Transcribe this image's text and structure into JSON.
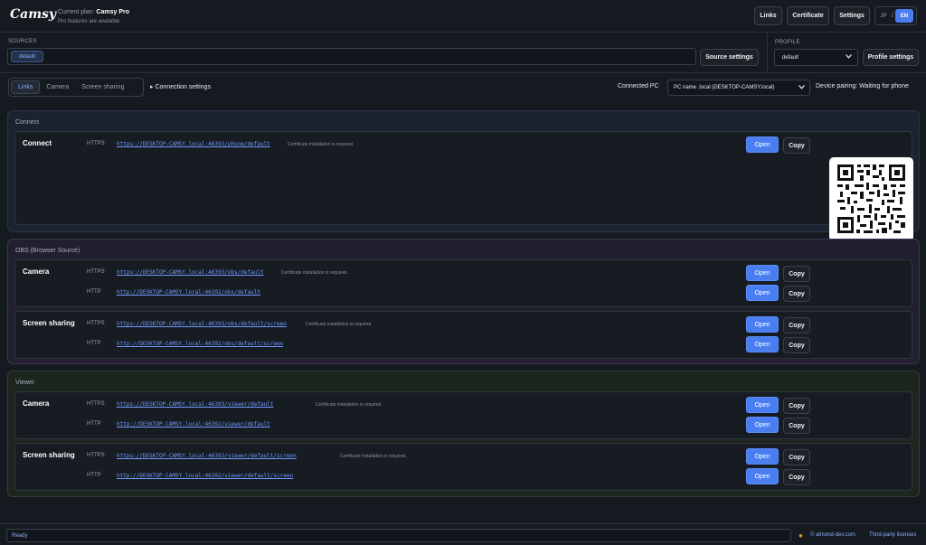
{
  "app": {
    "logo": "Camsy",
    "plan_label": "Current plan:",
    "plan_name": "Camsy Pro",
    "plan_note": "Pro features are available"
  },
  "header": {
    "links_label": "Links",
    "certificate_label": "Certificate",
    "settings_label": "Settings",
    "lang_jp": "JP",
    "lang_sep": "/",
    "lang_en": "EN"
  },
  "sources": {
    "label": "SOURCES",
    "chip": "default",
    "settings_button": "Source settings"
  },
  "profile": {
    "label": "PROFILE",
    "selected": "default",
    "settings_button": "Profile settings"
  },
  "tabs": [
    "Links",
    "Camera",
    "Screen sharing"
  ],
  "connection": {
    "settings_label": "Connection settings",
    "connected_pc_label": "Connected PC",
    "connected_pc_value": "PC name .local (DESKTOP-CAMSY.local)",
    "pairing_status": "Device pairing: Waiting for phone"
  },
  "buttons": {
    "open": "Open",
    "copy": "Copy"
  },
  "sections": {
    "connect": {
      "title": "Connect",
      "card_title": "Connect",
      "https_label": "HTTPS",
      "https_url": "https://DESKTOP-CAMSY.local:46393/phone/default",
      "note": "Certificate installation is required."
    },
    "obs": {
      "title": "OBS (Browser Source)",
      "camera": {
        "title": "Camera",
        "https_label": "HTTPS",
        "https_url": "https://DESKTOP-CAMSY.local:46393/obs/default",
        "note": "Certificate installation is required.",
        "http_label": "HTTP",
        "http_url": "http://DESKTOP-CAMSY.local:46392/obs/default"
      },
      "screen": {
        "title": "Screen sharing",
        "https_label": "HTTPS",
        "https_url": "https://DESKTOP-CAMSY.local:46393/obs/default/screen",
        "note": "Certificate installation is required.",
        "http_label": "HTTP",
        "http_url": "http://DESKTOP-CAMSY.local:46392/obs/default/screen"
      }
    },
    "viewer": {
      "title": "Viewer",
      "camera": {
        "title": "Camera",
        "https_label": "HTTPS",
        "https_url": "https://DESKTOP-CAMSY.local:46393/viewer/default",
        "note": "Certificate installation is required.",
        "http_label": "HTTP",
        "http_url": "http://DESKTOP-CAMSY.local:46392/viewer/default"
      },
      "screen": {
        "title": "Screen sharing",
        "https_label": "HTTPS",
        "https_url": "https://DESKTOP-CAMSY.local:46393/viewer/default/screen",
        "note": "Certificate installation is required.",
        "http_label": "HTTP",
        "http_url": "http://DESKTOP-CAMSY.local:46392/viewer/default/screen"
      }
    }
  },
  "footer": {
    "status": "Ready",
    "copyright": "© almond-dev.com",
    "licenses": "Third-party licenses"
  },
  "colors": {
    "accent": "#4a7ef0",
    "link": "#6f9cff",
    "connect_bg": "#1c2330",
    "obs_bg": "#221f2e",
    "viewer_bg": "#1d251f"
  }
}
